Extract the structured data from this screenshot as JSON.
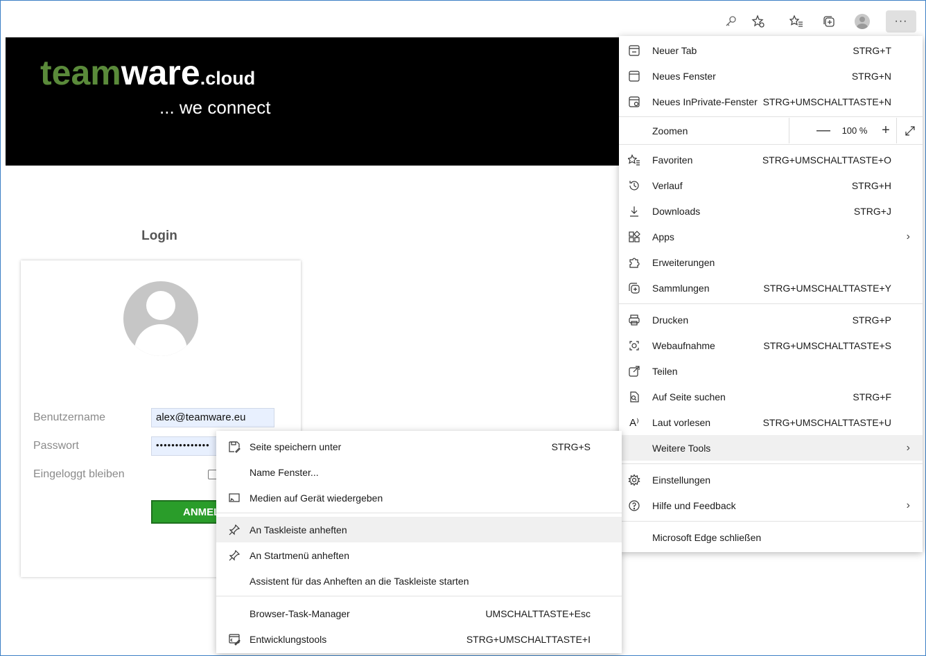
{
  "hero": {
    "logo_team": "team",
    "logo_ware": "ware",
    "logo_cloud": ".cloud",
    "tagline": "... we connect",
    "logo_green": "#5a8a3a"
  },
  "login": {
    "title": "Login",
    "username_label": "Benutzername",
    "username_value": "alex@teamware.eu",
    "password_label": "Passwort",
    "password_value": "••••••••••••••",
    "remember_label": "Eingeloggt bleiben",
    "submit_label": "ANMELDEN",
    "submit_color": "#2a9d2a"
  },
  "edge_menu": {
    "items": [
      {
        "label": "Neuer Tab",
        "shortcut": "STRG+T",
        "icon": "new-tab-icon"
      },
      {
        "label": "Neues Fenster",
        "shortcut": "STRG+N",
        "icon": "window-icon"
      },
      {
        "label": "Neues InPrivate-Fenster",
        "shortcut": "STRG+UMSCHALTTASTE+N",
        "icon": "inprivate-icon"
      },
      {
        "label": "Zoomen",
        "shortcut": "",
        "icon": ""
      },
      {
        "label": "Favoriten",
        "shortcut": "STRG+UMSCHALTTASTE+O",
        "icon": "favorites-icon"
      },
      {
        "label": "Verlauf",
        "shortcut": "STRG+H",
        "icon": "history-icon"
      },
      {
        "label": "Downloads",
        "shortcut": "STRG+J",
        "icon": "download-icon"
      },
      {
        "label": "Apps",
        "shortcut": "",
        "icon": "apps-icon"
      },
      {
        "label": "Erweiterungen",
        "shortcut": "",
        "icon": "extensions-icon"
      },
      {
        "label": "Sammlungen",
        "shortcut": "STRG+UMSCHALTTASTE+Y",
        "icon": "collections-icon"
      },
      {
        "label": "Drucken",
        "shortcut": "STRG+P",
        "icon": "print-icon"
      },
      {
        "label": "Webaufnahme",
        "shortcut": "STRG+UMSCHALTTASTE+S",
        "icon": "web-capture-icon"
      },
      {
        "label": "Teilen",
        "shortcut": "",
        "icon": "share-icon"
      },
      {
        "label": "Auf Seite suchen",
        "shortcut": "STRG+F",
        "icon": "find-icon"
      },
      {
        "label": "Laut vorlesen",
        "shortcut": "STRG+UMSCHALTTASTE+U",
        "icon": "read-aloud-icon"
      },
      {
        "label": "Weitere Tools",
        "shortcut": "",
        "icon": ""
      },
      {
        "label": "Einstellungen",
        "shortcut": "",
        "icon": "settings-icon"
      },
      {
        "label": "Hilfe und Feedback",
        "shortcut": "",
        "icon": "help-icon"
      },
      {
        "label": "Microsoft Edge schließen",
        "shortcut": "",
        "icon": ""
      }
    ],
    "zoom_value": "100 %",
    "zoom_minus": "—",
    "zoom_plus": "+",
    "read_aloud_glyph": "A⁾"
  },
  "sub_menu": {
    "items": [
      {
        "label": "Seite speichern unter",
        "shortcut": "STRG+S",
        "icon": "save-icon"
      },
      {
        "label": "Name Fenster...",
        "shortcut": "",
        "icon": ""
      },
      {
        "label": "Medien auf Gerät wiedergeben",
        "shortcut": "",
        "icon": "cast-icon"
      },
      {
        "label": "An Taskleiste anheften",
        "shortcut": "",
        "icon": "pin-icon"
      },
      {
        "label": "An Startmenü anheften",
        "shortcut": "",
        "icon": "pin-icon"
      },
      {
        "label": "Assistent für das Anheften an die Taskleiste starten",
        "shortcut": "",
        "icon": ""
      },
      {
        "label": "Browser-Task-Manager",
        "shortcut": "UMSCHALTTASTE+Esc",
        "icon": ""
      },
      {
        "label": "Entwicklungstools",
        "shortcut": "STRG+UMSCHALTTASTE+I",
        "icon": "devtools-icon"
      }
    ]
  },
  "toolbar": {
    "more_label": "···"
  }
}
